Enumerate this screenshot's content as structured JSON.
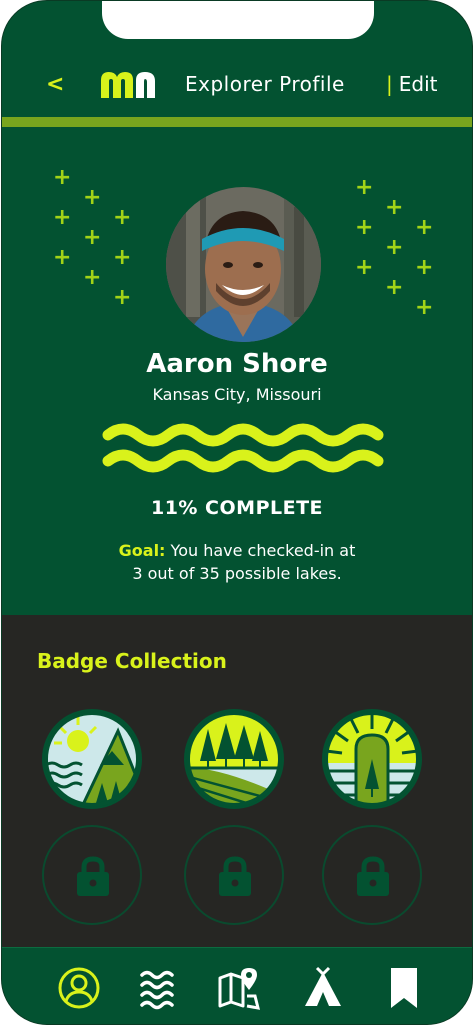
{
  "header": {
    "back_label": "<",
    "logo_icon": "mn-logo-icon",
    "title": "Explorer Profile",
    "edit_separator": "|",
    "edit_label": "Edit"
  },
  "profile": {
    "name": "Aaron Shore",
    "location": "Kansas City, Missouri",
    "progress_percent": 11,
    "progress_label": "11% COMPLETE",
    "goal_label": "Goal:",
    "goal_text_line1": "You have checked-in at",
    "goal_text_line2": "3 out of 35 possible lakes."
  },
  "badges": {
    "title": "Badge Collection",
    "earned": [
      "lake-cabin-badge-icon",
      "forest-field-badge-icon",
      "sunrise-tree-badge-icon"
    ],
    "locked_count": 3
  },
  "tabbar": {
    "items": [
      "profile-icon",
      "waves-icon",
      "map-pin-icon",
      "tent-icon",
      "bookmark-icon"
    ],
    "active": "profile-icon"
  },
  "colors": {
    "primary_green": "#035231",
    "accent_lime": "#d9f21b",
    "bar_green": "#79a51e",
    "dark_panel": "#262623"
  }
}
